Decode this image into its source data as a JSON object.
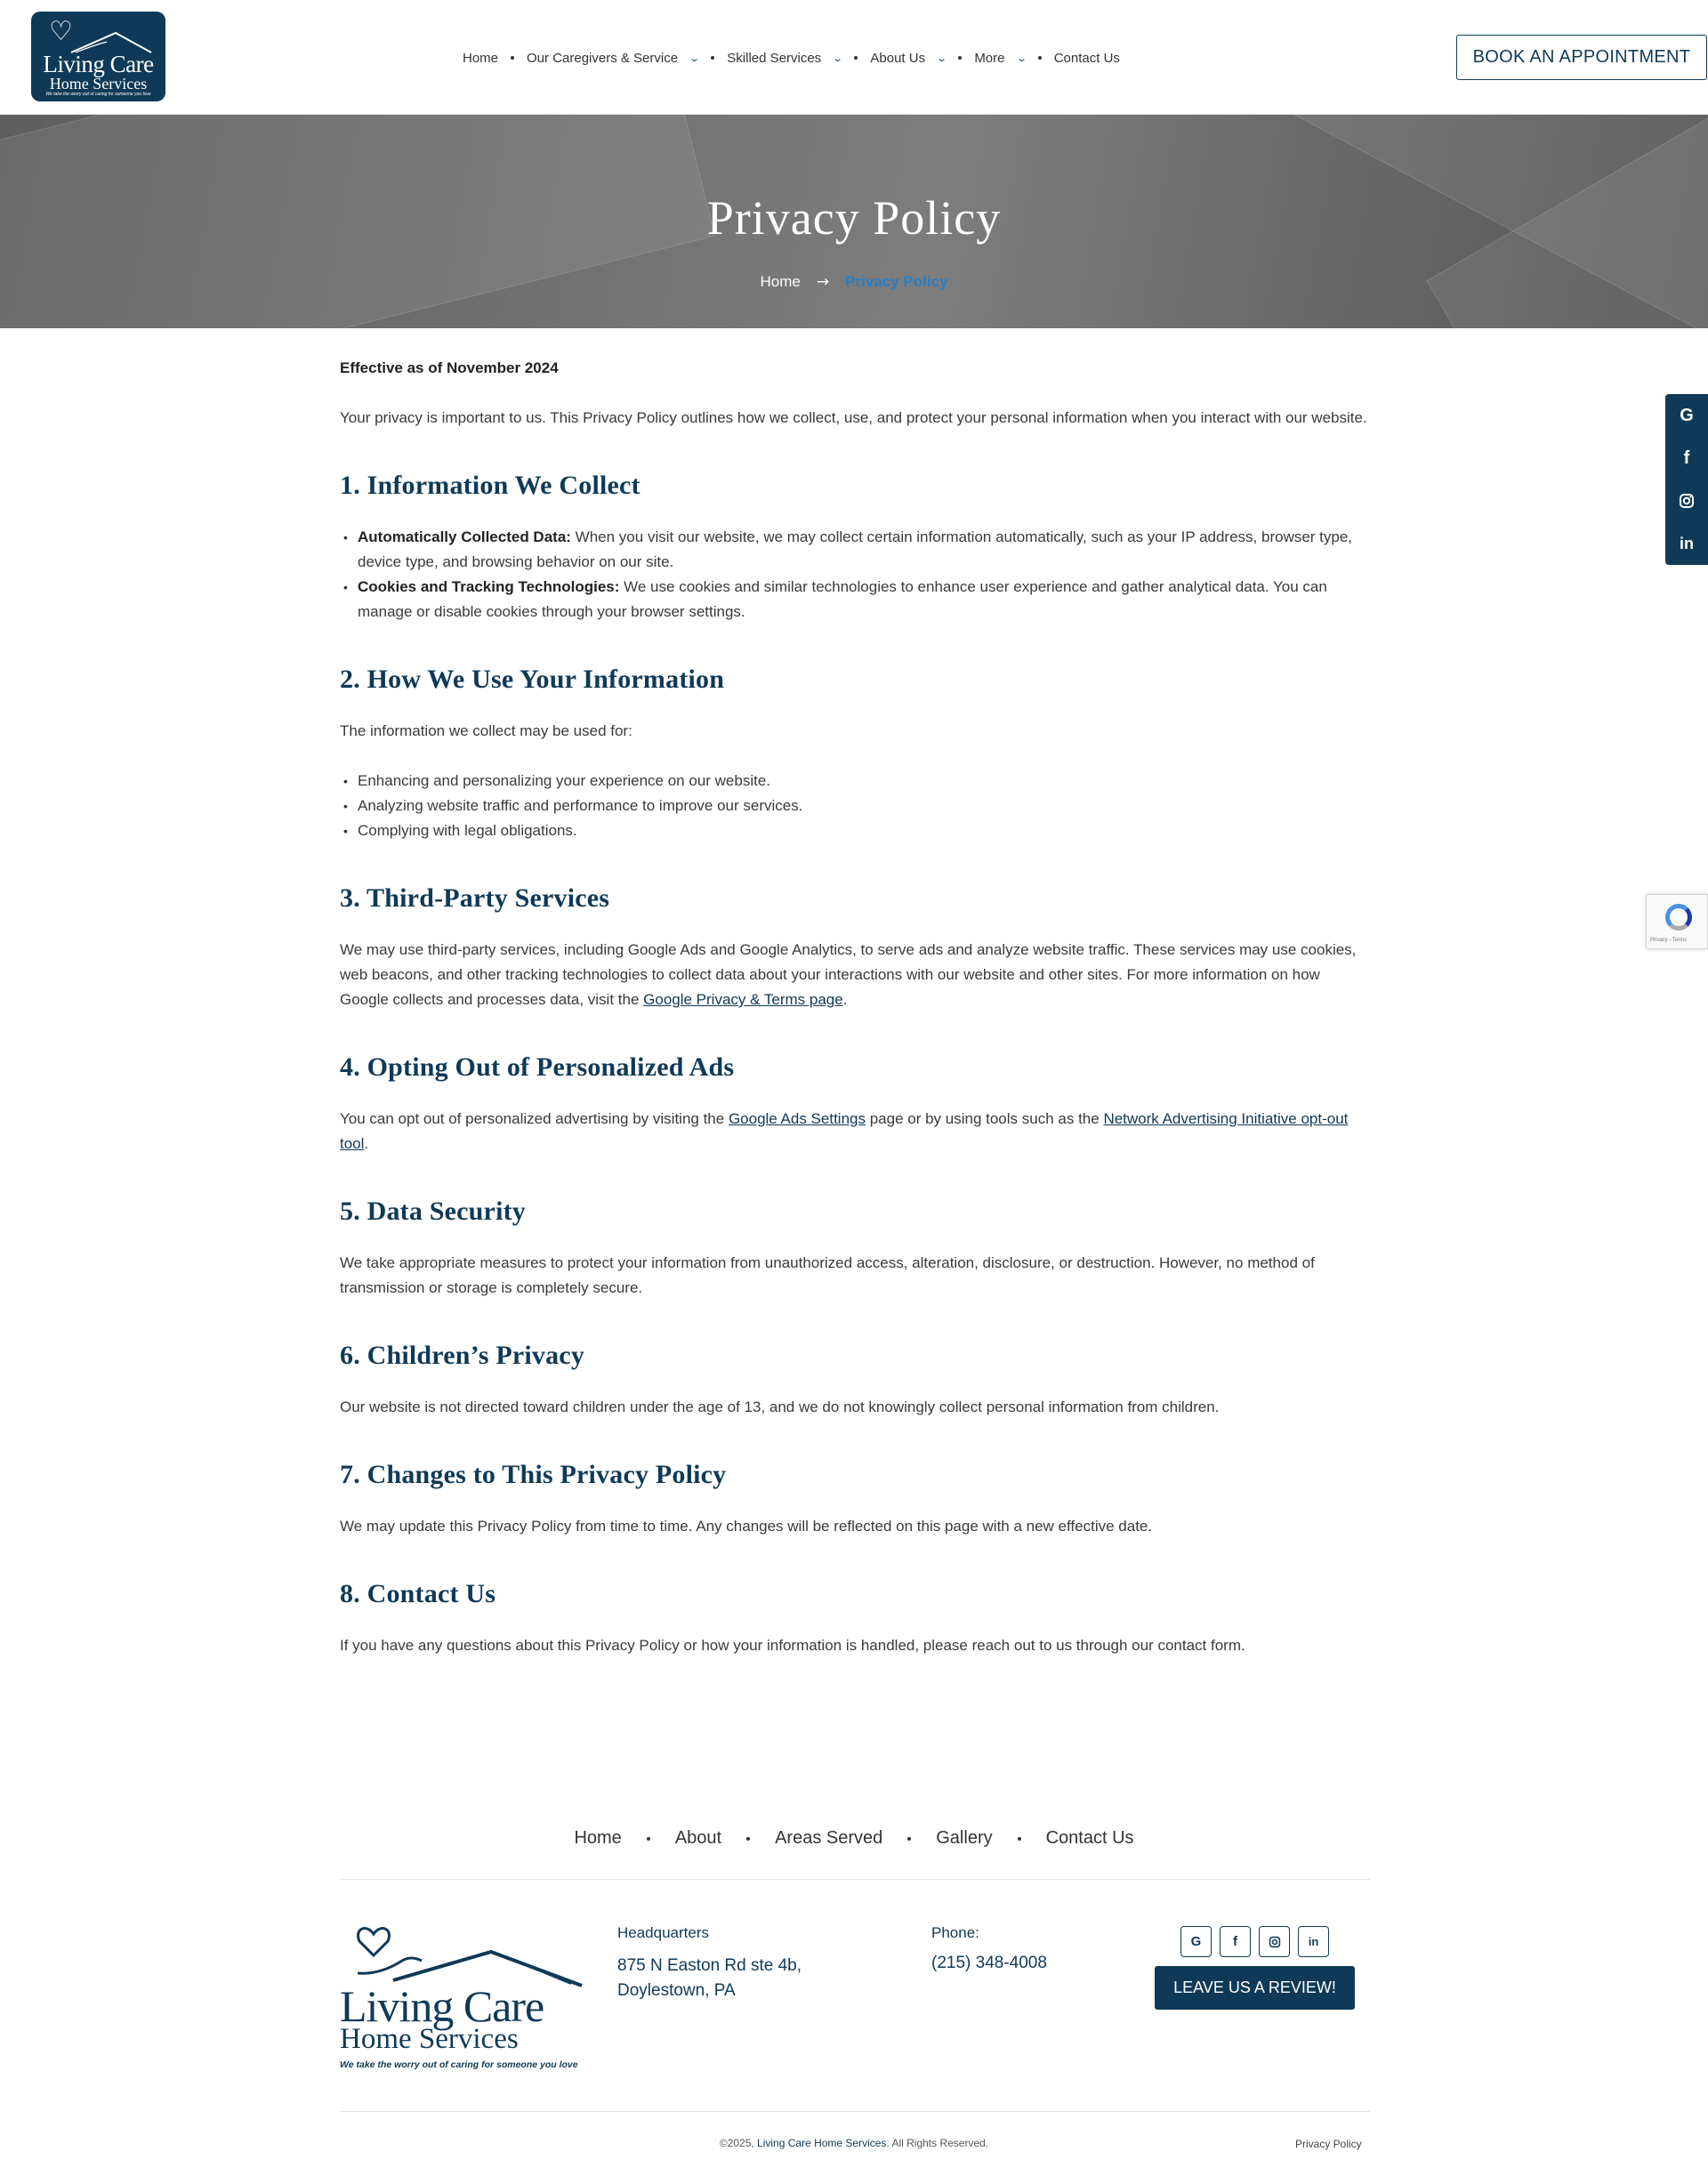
{
  "brand": {
    "name_line1": "Living Care",
    "name_line2": "Home Services",
    "tagline": "We take the worry out of caring for someone you love",
    "primary_color": "#0f3a57",
    "accent_color": "#2a7fc4"
  },
  "nav": {
    "items": [
      {
        "label": "Home",
        "has_dropdown": false
      },
      {
        "label": "Our Caregivers & Service",
        "has_dropdown": true
      },
      {
        "label": "Skilled Services",
        "has_dropdown": true
      },
      {
        "label": "About Us",
        "has_dropdown": true
      },
      {
        "label": "More",
        "has_dropdown": true
      },
      {
        "label": "Contact Us",
        "has_dropdown": false
      }
    ],
    "cta_label": "BOOK AN APPOINTMENT"
  },
  "hero": {
    "title": "Privacy Policy",
    "breadcrumb_home": "Home",
    "breadcrumb_current": "Privacy Policy"
  },
  "social_sidebar": [
    "google-icon",
    "facebook-icon",
    "instagram-icon",
    "linkedin-icon"
  ],
  "recaptcha": {
    "text": "Privacy - Terms"
  },
  "content": {
    "effective": "Effective as of November 2024",
    "intro": "Your privacy is important to us. This Privacy Policy outlines how we collect, use, and protect your personal information when you interact with our website.",
    "s1": {
      "heading": "1. Information We Collect",
      "items": [
        {
          "bold": "Automatically Collected Data:",
          "text": " When you visit our website, we may collect certain information automatically, such as your IP address, browser type, device type, and browsing behavior on our site."
        },
        {
          "bold": "Cookies and Tracking Technologies:",
          "text": " We use cookies and similar technologies to enhance user experience and gather analytical data. You can manage or disable cookies through your browser settings."
        }
      ]
    },
    "s2": {
      "heading": "2. How We Use Your Information",
      "lead": "The information we collect may be used for:",
      "items": [
        "Enhancing and personalizing your experience on our website.",
        "Analyzing website traffic and performance to improve our services.",
        "Complying with legal obligations."
      ]
    },
    "s3": {
      "heading": "3. Third-Party Services",
      "text_before": "We may use third-party services, including Google Ads and Google Analytics, to serve ads and analyze website traffic. These services may use cookies, web beacons, and other tracking technologies to collect data about your interactions with our website and other sites. For more information on how Google collects and processes data, visit the ",
      "link": "Google Privacy & Terms page",
      "text_after": "."
    },
    "s4": {
      "heading": "4. Opting Out of Personalized Ads",
      "text_before": "You can opt out of personalized advertising by visiting the ",
      "link1": "Google Ads Settings",
      "text_mid": " page or by using tools such as the ",
      "link2": "Network Advertising Initiative opt-out tool",
      "text_after": "."
    },
    "s5": {
      "heading": "5. Data Security",
      "text": "We take appropriate measures to protect your information from unauthorized access, alteration, disclosure, or destruction. However, no method of transmission or storage is completely secure."
    },
    "s6": {
      "heading": "6. Children’s Privacy",
      "text": "Our website is not directed toward children under the age of 13, and we do not knowingly collect personal information from children."
    },
    "s7": {
      "heading": "7. Changes to This Privacy Policy",
      "text": "We may update this Privacy Policy from time to time. Any changes will be reflected on this page with a new effective date."
    },
    "s8": {
      "heading": "8. Contact Us",
      "text": "If you have any questions about this Privacy Policy or how your information is handled, please reach out to us through our contact form."
    }
  },
  "footer": {
    "nav": [
      "Home",
      "About",
      "Areas Served",
      "Gallery",
      "Contact Us"
    ],
    "hq_title": "Headquarters",
    "hq_line1": "875 N Easton Rd ste 4b,",
    "hq_line2": "Doylestown, PA",
    "phone_title": "Phone:",
    "phone": "(215) 348-4008",
    "social": [
      "google-icon",
      "facebook-icon",
      "instagram-icon",
      "linkedin-icon"
    ],
    "review_label": "LEAVE US A REVIEW!",
    "copyright_prefix": "©2025, ",
    "copyright_brand": "Living Care Home Services",
    "copyright_suffix": ". All Rights Reserved.",
    "privacy_link": "Privacy Policy"
  }
}
